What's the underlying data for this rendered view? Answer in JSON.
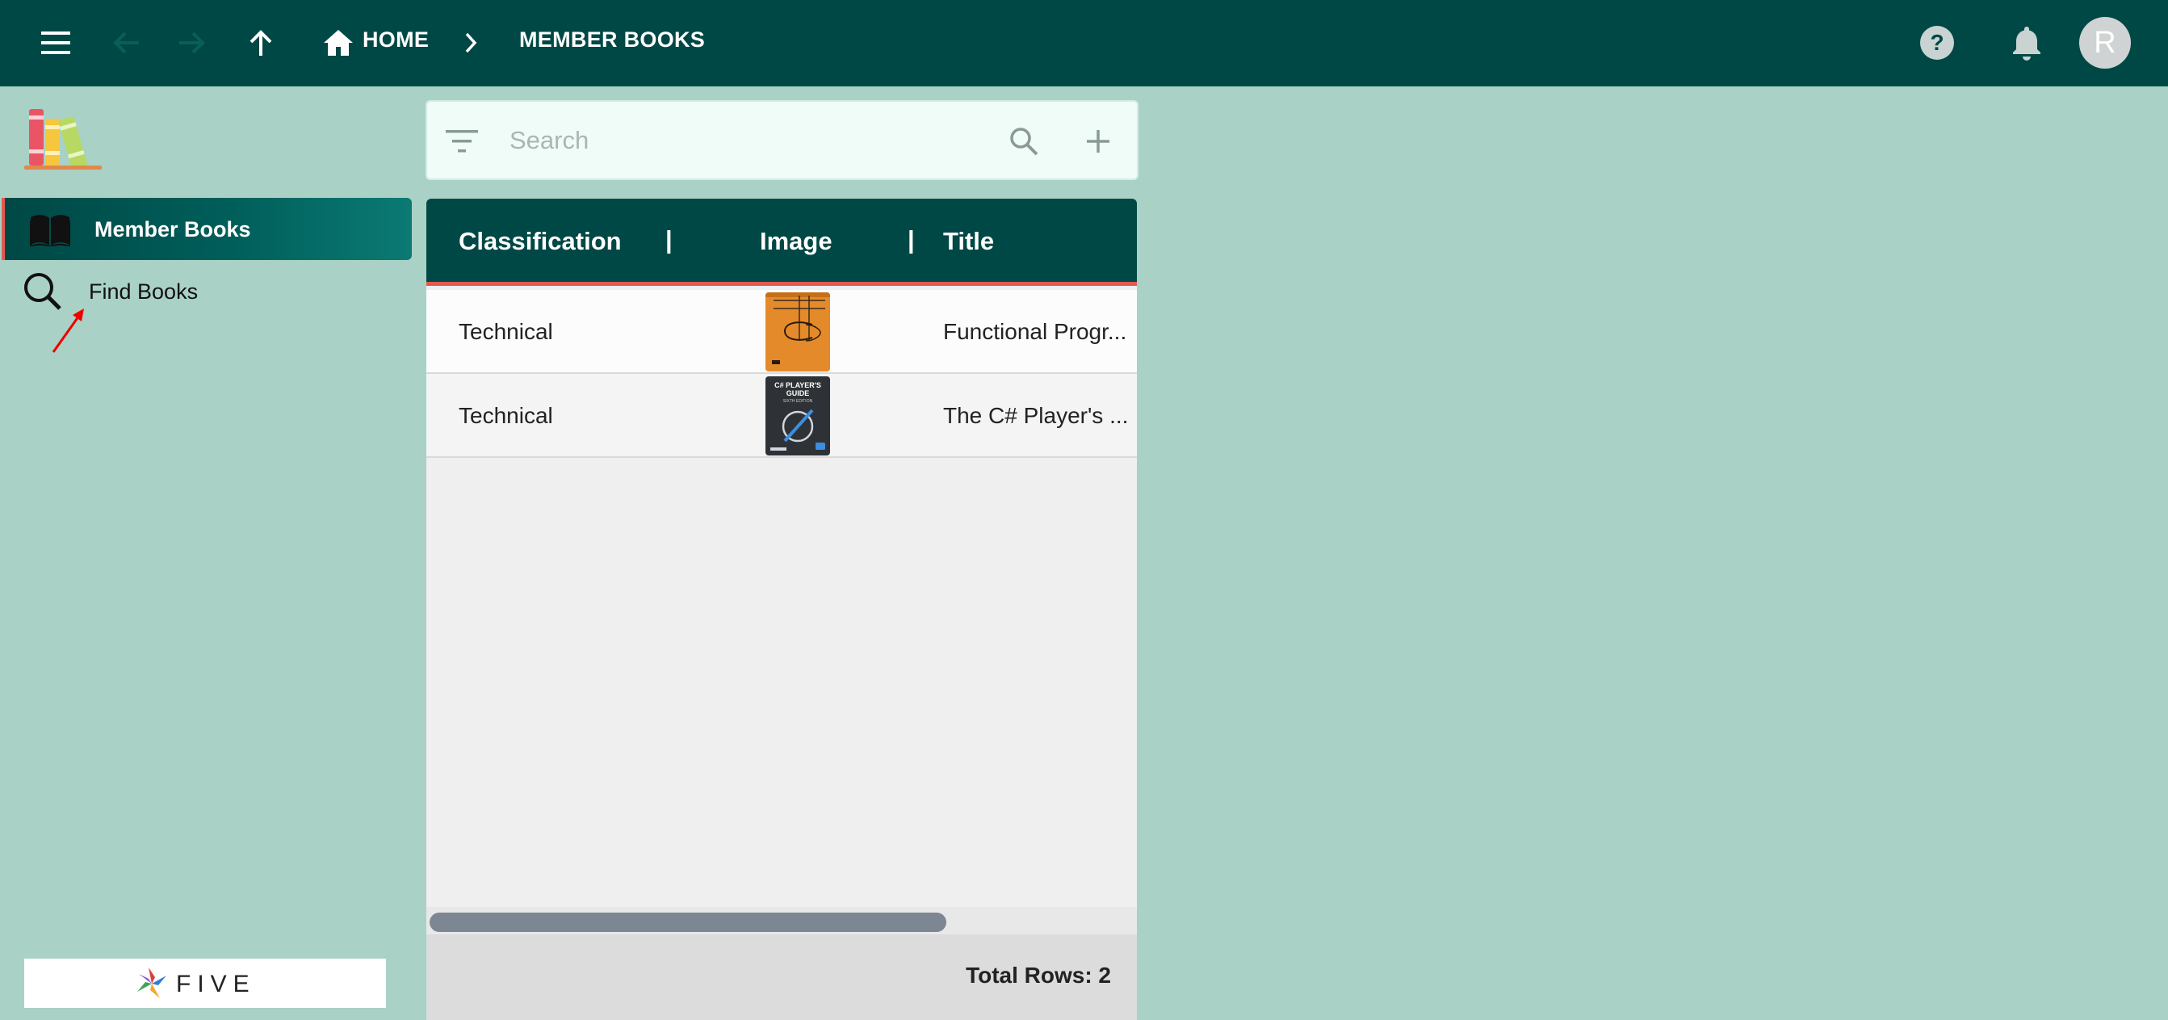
{
  "topbar": {
    "menu_icon": "hamburger-menu-icon",
    "back_icon": "arrow-left-icon",
    "forward_icon": "arrow-right-icon",
    "up_icon": "arrow-up-icon",
    "breadcrumb": {
      "home_label": "HOME",
      "separator_icon": "chevron-right-icon",
      "current_label": "MEMBER BOOKS"
    },
    "help_icon": "help-icon",
    "notifications_icon": "bell-icon",
    "avatar_initial": "R"
  },
  "sidebar": {
    "logo": "books-logo",
    "items": [
      {
        "label": "Member Books",
        "icon": "open-book-icon",
        "active": true
      },
      {
        "label": "Find Books",
        "icon": "search-icon",
        "active": false
      }
    ],
    "brand_logo_text": "FIVE"
  },
  "search": {
    "placeholder": "Search",
    "value": "",
    "filter_icon": "filter-icon",
    "search_icon": "search-icon",
    "add_icon": "plus-icon"
  },
  "table": {
    "columns": [
      "Classification",
      "Image",
      "Title"
    ],
    "rows": [
      {
        "classification": "Technical",
        "image": "book-cover-orange",
        "title": "Functional Progr..."
      },
      {
        "classification": "Technical",
        "image": "book-cover-csharp",
        "title": "The C# Player's ..."
      }
    ],
    "total_rows_label": "Total Rows: 2"
  },
  "colors": {
    "header_bg": "#004845",
    "page_bg": "#aad1c6",
    "accent": "#e15a4f",
    "search_bg": "#effcf7"
  }
}
